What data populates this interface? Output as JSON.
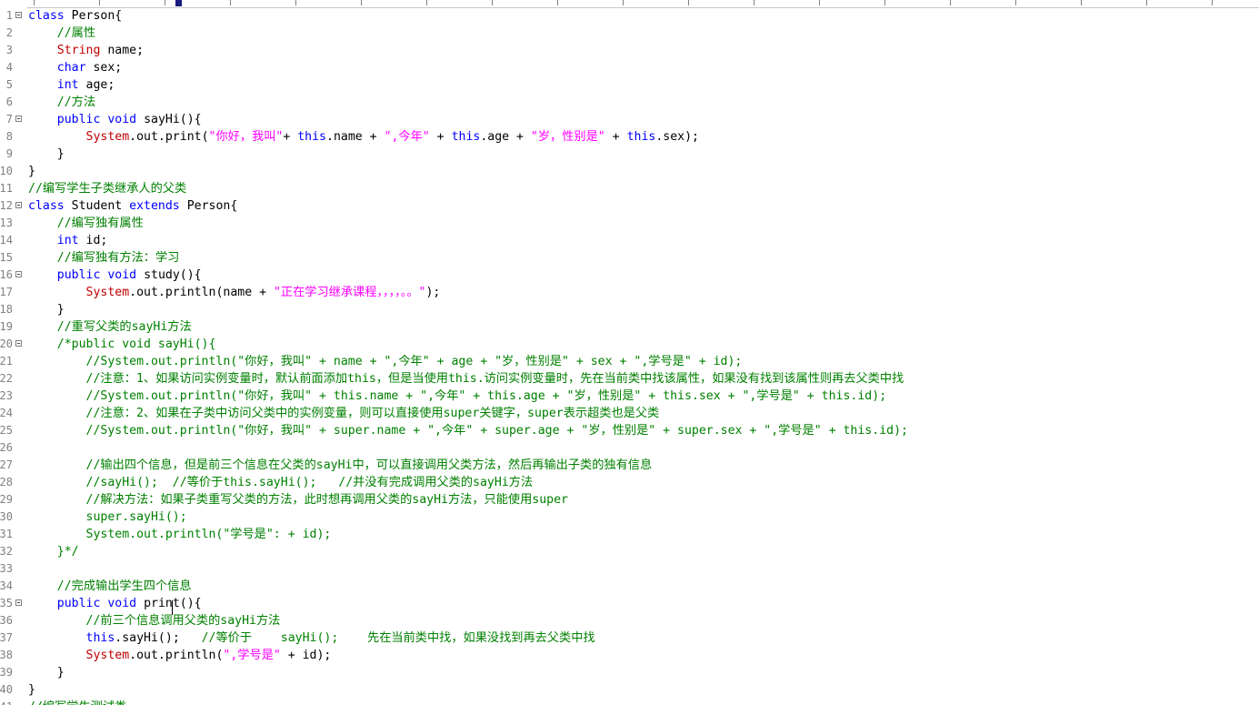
{
  "editor": {
    "lines": [
      {
        "n": "1",
        "fold": true,
        "segs": [
          [
            "kw",
            "class"
          ],
          [
            "p",
            " Person{"
          ]
        ]
      },
      {
        "n": "2",
        "fold": false,
        "segs": [
          [
            "p",
            "    "
          ],
          [
            "cm",
            "//属性"
          ]
        ]
      },
      {
        "n": "3",
        "fold": false,
        "segs": [
          [
            "p",
            "    "
          ],
          [
            "typ",
            "String"
          ],
          [
            "p",
            " name;"
          ]
        ]
      },
      {
        "n": "4",
        "fold": false,
        "segs": [
          [
            "p",
            "    "
          ],
          [
            "kw",
            "char"
          ],
          [
            "p",
            " sex;"
          ]
        ]
      },
      {
        "n": "5",
        "fold": false,
        "segs": [
          [
            "p",
            "    "
          ],
          [
            "kw",
            "int"
          ],
          [
            "p",
            " age;"
          ]
        ]
      },
      {
        "n": "6",
        "fold": false,
        "segs": [
          [
            "p",
            "    "
          ],
          [
            "cm",
            "//方法"
          ]
        ]
      },
      {
        "n": "7",
        "fold": true,
        "segs": [
          [
            "p",
            "    "
          ],
          [
            "kw",
            "public"
          ],
          [
            "p",
            " "
          ],
          [
            "kw",
            "void"
          ],
          [
            "p",
            " sayHi(){"
          ]
        ]
      },
      {
        "n": "8",
        "fold": false,
        "segs": [
          [
            "p",
            "        "
          ],
          [
            "sys",
            "System"
          ],
          [
            "p",
            ".out.print("
          ],
          [
            "str",
            "\"你好，我叫\""
          ],
          [
            "p",
            "+ "
          ],
          [
            "kw",
            "this"
          ],
          [
            "p",
            ".name + "
          ],
          [
            "str",
            "\",今年\""
          ],
          [
            "p",
            " + "
          ],
          [
            "kw",
            "this"
          ],
          [
            "p",
            ".age + "
          ],
          [
            "str",
            "\"岁，性别是\""
          ],
          [
            "p",
            " + "
          ],
          [
            "kw",
            "this"
          ],
          [
            "p",
            ".sex);"
          ]
        ]
      },
      {
        "n": "9",
        "fold": false,
        "segs": [
          [
            "p",
            "    }"
          ]
        ]
      },
      {
        "n": "10",
        "fold": false,
        "segs": [
          [
            "p",
            "}"
          ]
        ]
      },
      {
        "n": "11",
        "fold": false,
        "segs": [
          [
            "cm",
            "//编写学生子类继承人的父类"
          ]
        ]
      },
      {
        "n": "12",
        "fold": true,
        "segs": [
          [
            "kw",
            "class"
          ],
          [
            "p",
            " Student "
          ],
          [
            "kw",
            "extends"
          ],
          [
            "p",
            " Person{"
          ]
        ]
      },
      {
        "n": "13",
        "fold": false,
        "segs": [
          [
            "p",
            "    "
          ],
          [
            "cm",
            "//编写独有属性"
          ]
        ]
      },
      {
        "n": "14",
        "fold": false,
        "segs": [
          [
            "p",
            "    "
          ],
          [
            "kw",
            "int"
          ],
          [
            "p",
            " id;"
          ]
        ]
      },
      {
        "n": "15",
        "fold": false,
        "segs": [
          [
            "p",
            "    "
          ],
          [
            "cm",
            "//编写独有方法：学习"
          ]
        ]
      },
      {
        "n": "16",
        "fold": true,
        "segs": [
          [
            "p",
            "    "
          ],
          [
            "kw",
            "public"
          ],
          [
            "p",
            " "
          ],
          [
            "kw",
            "void"
          ],
          [
            "p",
            " study(){"
          ]
        ]
      },
      {
        "n": "17",
        "fold": false,
        "segs": [
          [
            "p",
            "        "
          ],
          [
            "sys",
            "System"
          ],
          [
            "p",
            ".out.println(name + "
          ],
          [
            "str",
            "\"正在学习继承课程，，，，。。\""
          ],
          [
            "p",
            ");"
          ]
        ]
      },
      {
        "n": "18",
        "fold": false,
        "segs": [
          [
            "p",
            "    }"
          ]
        ]
      },
      {
        "n": "19",
        "fold": false,
        "segs": [
          [
            "p",
            "    "
          ],
          [
            "cm",
            "//重写父类的sayHi方法"
          ]
        ]
      },
      {
        "n": "20",
        "fold": true,
        "segs": [
          [
            "p",
            "    "
          ],
          [
            "cm",
            "/*public void sayHi(){"
          ]
        ]
      },
      {
        "n": "21",
        "fold": false,
        "segs": [
          [
            "cm",
            "        //System.out.println(\"你好，我叫\" + name + \",今年\" + age + \"岁，性别是\" + sex + \",学号是\" + id);"
          ]
        ]
      },
      {
        "n": "22",
        "fold": false,
        "segs": [
          [
            "cm",
            "        //注意：1、如果访问实例变量时，默认前面添加this，但是当使用this.访问实例变量时，先在当前类中找该属性，如果没有找到该属性则再去父类中找"
          ]
        ]
      },
      {
        "n": "23",
        "fold": false,
        "segs": [
          [
            "cm",
            "        //System.out.println(\"你好，我叫\" + this.name + \",今年\" + this.age + \"岁，性别是\" + this.sex + \",学号是\" + this.id);"
          ]
        ]
      },
      {
        "n": "24",
        "fold": false,
        "segs": [
          [
            "cm",
            "        //注意：2、如果在子类中访问父类中的实例变量，则可以直接使用super关键字，super表示超类也是父类"
          ]
        ]
      },
      {
        "n": "25",
        "fold": false,
        "segs": [
          [
            "cm",
            "        //System.out.println(\"你好，我叫\" + super.name + \",今年\" + super.age + \"岁，性别是\" + super.sex + \",学号是\" + this.id);"
          ]
        ]
      },
      {
        "n": "26",
        "fold": false,
        "segs": [
          [
            "cm",
            ""
          ]
        ]
      },
      {
        "n": "27",
        "fold": false,
        "segs": [
          [
            "cm",
            "        //输出四个信息，但是前三个信息在父类的sayHi中，可以直接调用父类方法，然后再输出子类的独有信息"
          ]
        ]
      },
      {
        "n": "28",
        "fold": false,
        "segs": [
          [
            "cm",
            "        //sayHi();  //等价于this.sayHi();   //并没有完成调用父类的sayHi方法"
          ]
        ]
      },
      {
        "n": "29",
        "fold": false,
        "segs": [
          [
            "cm",
            "        //解决方法：如果子类重写父类的方法，此时想再调用父类的sayHi方法，只能使用super"
          ]
        ]
      },
      {
        "n": "30",
        "fold": false,
        "segs": [
          [
            "cm",
            "        super.sayHi();"
          ]
        ]
      },
      {
        "n": "31",
        "fold": false,
        "segs": [
          [
            "cm",
            "        System.out.println(\"学号是\": + id);"
          ]
        ]
      },
      {
        "n": "32",
        "fold": false,
        "segs": [
          [
            "cm",
            "    }*/"
          ]
        ]
      },
      {
        "n": "33",
        "fold": false,
        "segs": [
          [
            "p",
            ""
          ]
        ]
      },
      {
        "n": "34",
        "fold": false,
        "segs": [
          [
            "p",
            "    "
          ],
          [
            "cm",
            "//完成输出学生四个信息"
          ]
        ]
      },
      {
        "n": "35",
        "fold": true,
        "segs": [
          [
            "p",
            "    "
          ],
          [
            "kw",
            "public"
          ],
          [
            "p",
            " "
          ],
          [
            "kw",
            "void"
          ],
          [
            "p",
            " print(){"
          ]
        ]
      },
      {
        "n": "36",
        "fold": false,
        "segs": [
          [
            "p",
            "        "
          ],
          [
            "cm",
            "//前三个信息调用父类的sayHi方法"
          ]
        ]
      },
      {
        "n": "37",
        "fold": false,
        "segs": [
          [
            "p",
            "        "
          ],
          [
            "kw",
            "this"
          ],
          [
            "p",
            ".sayHi();   "
          ],
          [
            "cm",
            "//等价于    sayHi();    先在当前类中找，如果没找到再去父类中找"
          ]
        ]
      },
      {
        "n": "38",
        "fold": false,
        "segs": [
          [
            "p",
            "        "
          ],
          [
            "sys",
            "System"
          ],
          [
            "p",
            ".out.println("
          ],
          [
            "str",
            "\",学号是\""
          ],
          [
            "p",
            " + id);"
          ]
        ]
      },
      {
        "n": "39",
        "fold": false,
        "segs": [
          [
            "p",
            "    }"
          ]
        ]
      },
      {
        "n": "40",
        "fold": false,
        "segs": [
          [
            "p",
            "}"
          ]
        ]
      },
      {
        "n": "41",
        "fold": false,
        "segs": [
          [
            "cm",
            "//编写学生测试类"
          ]
        ]
      }
    ]
  }
}
